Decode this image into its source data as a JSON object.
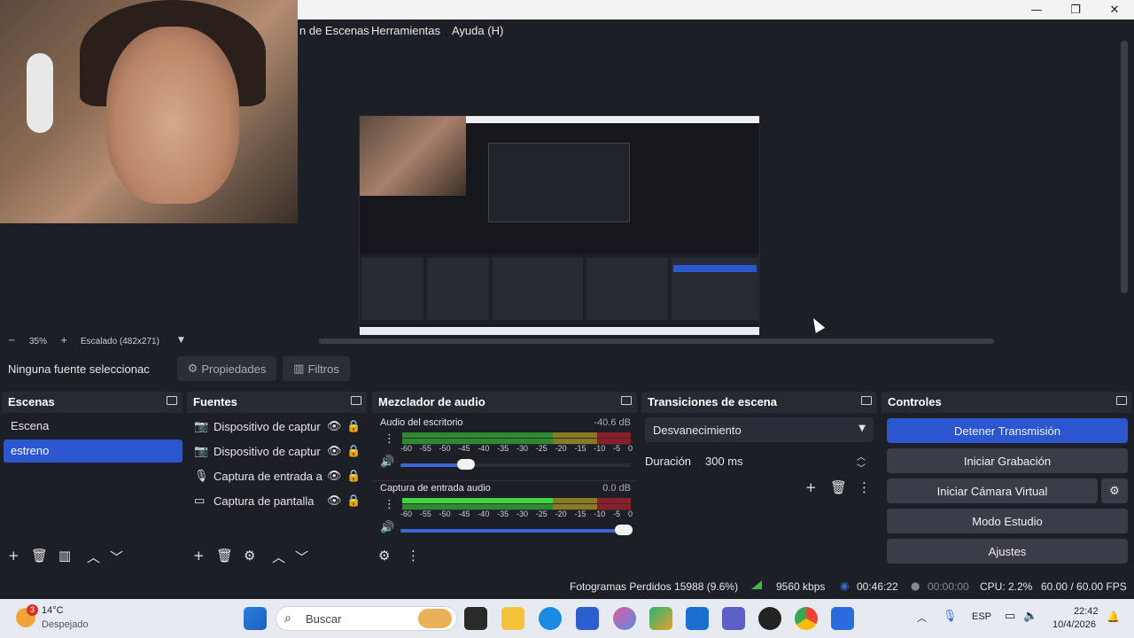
{
  "window": {
    "minimize": "—",
    "maximize": "❐",
    "close": "✕"
  },
  "menu": {
    "items": [
      "n de Escenas",
      "Herramientas",
      "Ayuda (H)"
    ]
  },
  "preview": {
    "zoom": "35%",
    "scale_label": "Escalado (482x271)"
  },
  "source_bar": {
    "status": "Ninguna fuente seleccionac",
    "properties": "Propiedades",
    "filters": "Filtros"
  },
  "scenes": {
    "title": "Escenas",
    "items": [
      "Escena",
      "estreno"
    ],
    "selected": "estreno"
  },
  "sources": {
    "title": "Fuentes",
    "items": [
      {
        "label": "Dispositivo de captur",
        "icon": "camera-icon"
      },
      {
        "label": "Dispositivo de captur",
        "icon": "camera-icon"
      },
      {
        "label": "Captura de entrada a",
        "icon": "microphone-icon"
      },
      {
        "label": "Captura de pantalla",
        "icon": "monitor-icon"
      }
    ]
  },
  "mixer": {
    "title": "Mezclador de audio",
    "channels": [
      {
        "name": "Audio del escritorio",
        "db": "-40.6 dB",
        "level": 0.25
      },
      {
        "name": "Captura de entrada audio",
        "db": "0.0 dB",
        "level": 1.0
      }
    ],
    "scale": [
      "-60",
      "-55",
      "-50",
      "-45",
      "-40",
      "-35",
      "-30",
      "-25",
      "-20",
      "-15",
      "-10",
      "-5",
      "0"
    ]
  },
  "transitions": {
    "title": "Transiciones de escena",
    "selected": "Desvanecimiento",
    "duration_label": "Duración",
    "duration_value": "300 ms"
  },
  "controls": {
    "title": "Controles",
    "stream": "Detener Transmisión",
    "record": "Iniciar Grabación",
    "virtual_cam": "Iniciar Cámara Virtual",
    "studio": "Modo Estudio",
    "settings": "Ajustes"
  },
  "status": {
    "dropped": "Fotogramas Perdidos 15988 (9.6%)",
    "bitrate": "9560 kbps",
    "stream_time": "00:46:22",
    "rec_time": "00:00:00",
    "cpu": "CPU: 2.2%",
    "fps": "60.00 / 60.00 FPS"
  },
  "taskbar": {
    "weather_temp": "14°C",
    "weather_desc": "Despejado",
    "weather_badge": "3",
    "search": "Buscar",
    "lang": "ESP",
    "time": "22:42",
    "date": "10/4/2026"
  },
  "colors": {
    "accent": "#2c55d0",
    "panel": "#272a33",
    "bg": "#1d1f26",
    "meter_green": "#3aa33a",
    "meter_yellow": "#b0a32a",
    "meter_red": "#a32a2a"
  }
}
